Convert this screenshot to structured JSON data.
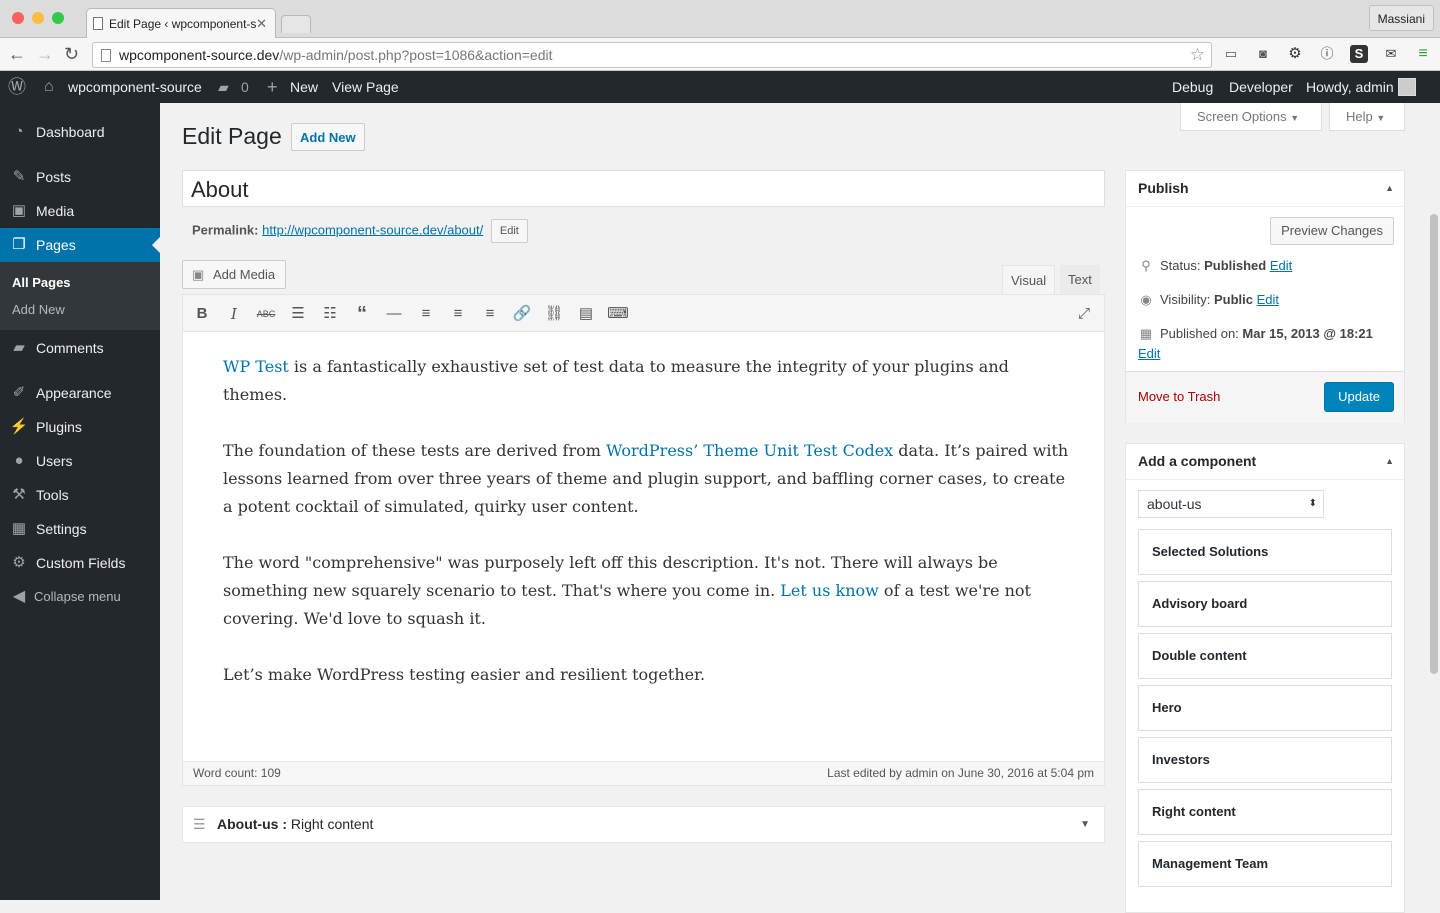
{
  "browser": {
    "tab_title": "Edit Page ‹ wpcomponent-s",
    "profile": "Massiani",
    "url_host": "wpcomponent-source.dev",
    "url_path": "/wp-admin/post.php?post=1086&action=edit"
  },
  "adminbar": {
    "site_name": "wpcomponent-source",
    "comments_count": "0",
    "new_label": "New",
    "view_page": "View Page",
    "debug": "Debug",
    "developer": "Developer",
    "howdy": "Howdy, admin"
  },
  "sidebar": {
    "items": [
      {
        "label": "Dashboard",
        "icon": "dashboard-icon"
      },
      {
        "label": "Posts",
        "icon": "pin-icon"
      },
      {
        "label": "Media",
        "icon": "media-icon"
      },
      {
        "label": "Pages",
        "icon": "pages-icon"
      },
      {
        "label": "Comments",
        "icon": "comment-icon"
      },
      {
        "label": "Appearance",
        "icon": "brush-icon"
      },
      {
        "label": "Plugins",
        "icon": "plugin-icon"
      },
      {
        "label": "Users",
        "icon": "user-icon"
      },
      {
        "label": "Tools",
        "icon": "wrench-icon"
      },
      {
        "label": "Settings",
        "icon": "settings-icon"
      },
      {
        "label": "Custom Fields",
        "icon": "gear-icon"
      }
    ],
    "submenu": [
      "All Pages",
      "Add New"
    ],
    "collapse": "Collapse menu"
  },
  "screen_options": "Screen Options",
  "help": "Help",
  "page": {
    "heading": "Edit Page",
    "add_new": "Add New",
    "title_value": "About",
    "permalink_label": "Permalink:",
    "permalink_url": "http://wpcomponent-source.dev/about/",
    "permalink_edit": "Edit",
    "add_media": "Add Media",
    "tab_visual": "Visual",
    "tab_text": "Text"
  },
  "content": {
    "p1_link": "WP Test",
    "p1_rest": " is a fantastically exhaustive set of test data to measure the integrity of your plugins and themes.",
    "p2_start": "The foundation of these tests are derived from ",
    "p2_link": "WordPress’ Theme Unit Test Codex",
    "p2_rest": " data. It’s paired with lessons learned from over three years of theme and plugin support, and baffling corner cases, to create a potent cocktail of simulated, quirky user content.",
    "p3_start": "The word \"comprehensive\" was purposely left off this description. It's not. There will always be something new squarely scenario to test. That's where you come in. ",
    "p3_link": "Let us know",
    "p3_rest": " of a test we're not covering. We'd love to squash it.",
    "p4": "Let’s make WordPress testing easier and resilient together."
  },
  "status": {
    "word_count": "Word count: 109",
    "last_edited": "Last edited by admin on June 30, 2016 at 5:04 pm"
  },
  "metabox": {
    "title_bold": "About-us :",
    "title_rest": " Right content"
  },
  "publish": {
    "title": "Publish",
    "preview": "Preview Changes",
    "status_label": "Status:",
    "status_value": "Published",
    "visibility_label": "Visibility:",
    "visibility_value": "Public",
    "published_label": "Published on:",
    "published_value": "Mar 15, 2013 @ 18:21",
    "edit": "Edit",
    "trash": "Move to Trash",
    "update": "Update"
  },
  "component": {
    "title": "Add a component",
    "selected": "about-us",
    "items": [
      "Selected Solutions",
      "Advisory board",
      "Double content",
      "Hero",
      "Investors",
      "Right content",
      "Management Team"
    ]
  }
}
